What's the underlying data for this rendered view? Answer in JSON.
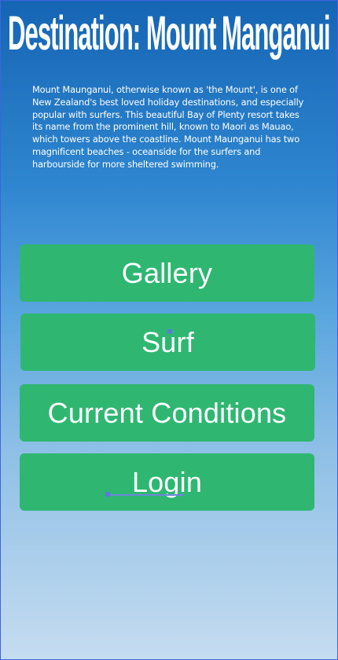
{
  "page": {
    "title": "Destination: Mount Manganui",
    "description": "Mount Maunganui, otherwise known as 'the Mount', is one of New Zealand's best loved holiday destinations, and especially popular with surfers. This beautiful Bay of Plenty resort takes its name from the prominent hill, known to Maori as Mauao, which towers above the coastline. Mount Maunganui has two magnificent beaches - oceanside for the surfers and harbourside for more sheltered swimming."
  },
  "menu": {
    "gallery_label": "Gallery",
    "surf_label": "Surf",
    "conditions_label": "Current Conditions",
    "login_label": "Login"
  },
  "colors": {
    "button": "#2fb772",
    "background_top": "#1565b4",
    "background_bottom": "#c5dcf0",
    "border": "#3f63e0"
  }
}
